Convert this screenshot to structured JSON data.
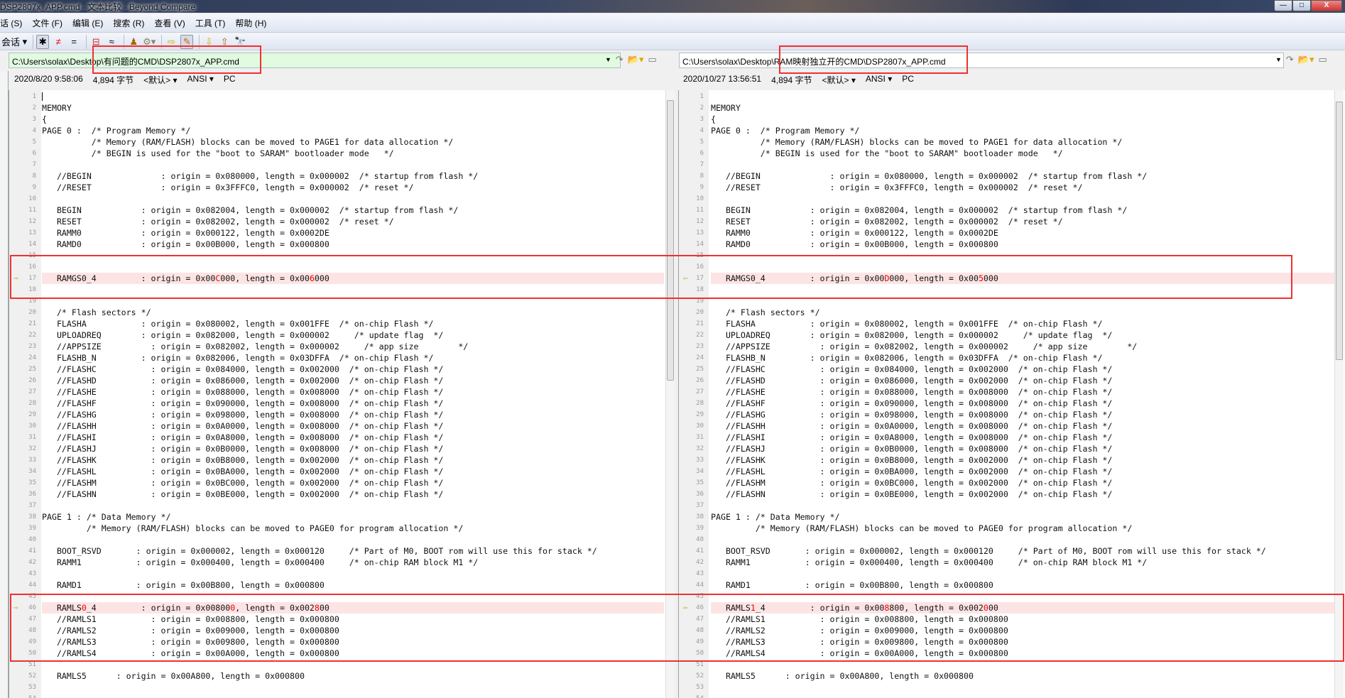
{
  "window": {
    "title": "DSP2807x_APP.cmd - 文本比较 - Beyond Compare",
    "minimize": "—",
    "maximize": "□",
    "close": "X"
  },
  "menu": [
    "话 (S)",
    "文件 (F)",
    "编辑 (E)",
    "搜索 (R)",
    "查看 (V)",
    "工具 (T)",
    "帮助 (H)"
  ],
  "toolbar": {
    "session_label": "会话",
    "icons": [
      "session-icon",
      "show-all-icon",
      "show-differences-icon",
      "show-same-icon",
      "context-icon",
      "minor-icon",
      "rules-icon",
      "format-icon",
      "next-section-icon",
      "edit-icon",
      "next-difference-icon",
      "prev-difference-icon",
      "find-icon"
    ]
  },
  "colors": {
    "changed_line": "#fde4e4",
    "changed_text": "#ee0000",
    "left_path_bg": "#e0fbe0",
    "highlight_box": "#f03030"
  },
  "left": {
    "path": "C:\\Users\\solax\\Desktop\\有问题的CMD\\DSP2807x_APP.cmd",
    "info": {
      "timestamp": "2020/8/20 9:58:06",
      "size": "4,894 字节",
      "format": "<默认>",
      "encoding": "ANSI",
      "line_endings": "PC"
    },
    "lines": [
      "",
      "MEMORY",
      "{",
      "PAGE 0 :  /* Program Memory */",
      "          /* Memory (RAM/FLASH) blocks can be moved to PAGE1 for data allocation */",
      "          /* BEGIN is used for the \"boot to SARAM\" bootloader mode   */",
      "",
      "   //BEGIN              : origin = 0x080000, length = 0x000002  /* startup from flash */",
      "   //RESET              : origin = 0x3FFFC0, length = 0x000002  /* reset */",
      "",
      "   BEGIN            : origin = 0x082004, length = 0x000002  /* startup from flash */",
      "   RESET            : origin = 0x082002, length = 0x000002  /* reset */",
      "   RAMM0            : origin = 0x000122, length = 0x0002DE",
      "   RAMD0            : origin = 0x00B000, length = 0x000800",
      "",
      "",
      [
        {
          "text": "   RAMGS0_4         : origin = 0x00",
          "changed": false
        },
        {
          "text": "C",
          "changed": true
        },
        {
          "text": "000, length = 0x00",
          "changed": false
        },
        {
          "text": "6",
          "changed": true
        },
        {
          "text": "000",
          "changed": false
        }
      ],
      "",
      "",
      "   /* Flash sectors */",
      "   FLASHA           : origin = 0x080002, length = 0x001FFE  /* on-chip Flash */",
      "   UPLOADREQ        : origin = 0x082000, length = 0x000002     /* update flag  */",
      "   //APPSIZE          : origin = 0x082002, length = 0x000002     /* app size        */",
      "   FLASHB_N         : origin = 0x082006, length = 0x03DFFA  /* on-chip Flash */",
      "   //FLASHC           : origin = 0x084000, length = 0x002000  /* on-chip Flash */",
      "   //FLASHD           : origin = 0x086000, length = 0x002000  /* on-chip Flash */",
      "   //FLASHE           : origin = 0x088000, length = 0x008000  /* on-chip Flash */",
      "   //FLASHF           : origin = 0x090000, length = 0x008000  /* on-chip Flash */",
      "   //FLASHG           : origin = 0x098000, length = 0x008000  /* on-chip Flash */",
      "   //FLASHH           : origin = 0x0A0000, length = 0x008000  /* on-chip Flash */",
      "   //FLASHI           : origin = 0x0A8000, length = 0x008000  /* on-chip Flash */",
      "   //FLASHJ           : origin = 0x0B0000, length = 0x008000  /* on-chip Flash */",
      "   //FLASHK           : origin = 0x0B8000, length = 0x002000  /* on-chip Flash */",
      "   //FLASHL           : origin = 0x0BA000, length = 0x002000  /* on-chip Flash */",
      "   //FLASHM           : origin = 0x0BC000, length = 0x002000  /* on-chip Flash */",
      "   //FLASHN           : origin = 0x0BE000, length = 0x002000  /* on-chip Flash */",
      "",
      "PAGE 1 : /* Data Memory */",
      "         /* Memory (RAM/FLASH) blocks can be moved to PAGE0 for program allocation */",
      "",
      "   BOOT_RSVD       : origin = 0x000002, length = 0x000120     /* Part of M0, BOOT rom will use this for stack */",
      "   RAMM1           : origin = 0x000400, length = 0x000400     /* on-chip RAM block M1 */",
      "",
      "   RAMD1           : origin = 0x00B800, length = 0x000800",
      "",
      [
        {
          "text": "   RAMLS",
          "changed": false
        },
        {
          "text": "0",
          "changed": true
        },
        {
          "text": "_4         : origin = 0x00800",
          "changed": false
        },
        {
          "text": "0",
          "changed": true
        },
        {
          "text": ", length = 0x002",
          "changed": false
        },
        {
          "text": "8",
          "changed": true
        },
        {
          "text": "00",
          "changed": false
        }
      ],
      "   //RAMLS1           : origin = 0x008800, length = 0x000800",
      "   //RAMLS2           : origin = 0x009000, length = 0x000800",
      "   //RAMLS3           : origin = 0x009800, length = 0x000800",
      "   //RAMLS4           : origin = 0x00A000, length = 0x000800",
      "",
      "   RAMLS5      : origin = 0x00A800, length = 0x000800",
      "",
      ""
    ]
  },
  "right": {
    "path": "C:\\Users\\solax\\Desktop\\RAM映射独立开的CMD\\DSP2807x_APP.cmd",
    "info": {
      "timestamp": "2020/10/27 13:56:51",
      "size": "4,894 字节",
      "format": "<默认>",
      "encoding": "ANSI",
      "line_endings": "PC"
    },
    "lines": [
      "",
      "MEMORY",
      "{",
      "PAGE 0 :  /* Program Memory */",
      "          /* Memory (RAM/FLASH) blocks can be moved to PAGE1 for data allocation */",
      "          /* BEGIN is used for the \"boot to SARAM\" bootloader mode   */",
      "",
      "   //BEGIN              : origin = 0x080000, length = 0x000002  /* startup from flash */",
      "   //RESET              : origin = 0x3FFFC0, length = 0x000002  /* reset */",
      "",
      "   BEGIN            : origin = 0x082004, length = 0x000002  /* startup from flash */",
      "   RESET            : origin = 0x082002, length = 0x000002  /* reset */",
      "   RAMM0            : origin = 0x000122, length = 0x0002DE",
      "   RAMD0            : origin = 0x00B000, length = 0x000800",
      "",
      "",
      [
        {
          "text": "   RAMGS0_4         : origin = 0x00",
          "changed": false
        },
        {
          "text": "D",
          "changed": true
        },
        {
          "text": "000, length = 0x00",
          "changed": false
        },
        {
          "text": "5",
          "changed": true
        },
        {
          "text": "000",
          "changed": false
        }
      ],
      "",
      "",
      "   /* Flash sectors */",
      "   FLASHA           : origin = 0x080002, length = 0x001FFE  /* on-chip Flash */",
      "   UPLOADREQ        : origin = 0x082000, length = 0x000002     /* update flag  */",
      "   //APPSIZE          : origin = 0x082002, length = 0x000002     /* app size        */",
      "   FLASHB_N         : origin = 0x082006, length = 0x03DFFA  /* on-chip Flash */",
      "   //FLASHC           : origin = 0x084000, length = 0x002000  /* on-chip Flash */",
      "   //FLASHD           : origin = 0x086000, length = 0x002000  /* on-chip Flash */",
      "   //FLASHE           : origin = 0x088000, length = 0x008000  /* on-chip Flash */",
      "   //FLASHF           : origin = 0x090000, length = 0x008000  /* on-chip Flash */",
      "   //FLASHG           : origin = 0x098000, length = 0x008000  /* on-chip Flash */",
      "   //FLASHH           : origin = 0x0A0000, length = 0x008000  /* on-chip Flash */",
      "   //FLASHI           : origin = 0x0A8000, length = 0x008000  /* on-chip Flash */",
      "   //FLASHJ           : origin = 0x0B0000, length = 0x008000  /* on-chip Flash */",
      "   //FLASHK           : origin = 0x0B8000, length = 0x002000  /* on-chip Flash */",
      "   //FLASHL           : origin = 0x0BA000, length = 0x002000  /* on-chip Flash */",
      "   //FLASHM           : origin = 0x0BC000, length = 0x002000  /* on-chip Flash */",
      "   //FLASHN           : origin = 0x0BE000, length = 0x002000  /* on-chip Flash */",
      "",
      "PAGE 1 : /* Data Memory */",
      "         /* Memory (RAM/FLASH) blocks can be moved to PAGE0 for program allocation */",
      "",
      "   BOOT_RSVD       : origin = 0x000002, length = 0x000120     /* Part of M0, BOOT rom will use this for stack */",
      "   RAMM1           : origin = 0x000400, length = 0x000400     /* on-chip RAM block M1 */",
      "",
      "   RAMD1           : origin = 0x00B800, length = 0x000800",
      "",
      [
        {
          "text": "   RAMLS",
          "changed": false
        },
        {
          "text": "1",
          "changed": true
        },
        {
          "text": "_4         : origin = 0x00",
          "changed": false
        },
        {
          "text": "8",
          "changed": true
        },
        {
          "text": "800, length = 0x002",
          "changed": false
        },
        {
          "text": "0",
          "changed": true
        },
        {
          "text": "00",
          "changed": false
        }
      ],
      "   //RAMLS1           : origin = 0x008800, length = 0x000800",
      "   //RAMLS2           : origin = 0x009000, length = 0x000800",
      "   //RAMLS3           : origin = 0x009800, length = 0x000800",
      "   //RAMLS4           : origin = 0x00A000, length = 0x000800",
      "",
      "   RAMLS5      : origin = 0x00A800, length = 0x000800",
      "",
      ""
    ]
  }
}
